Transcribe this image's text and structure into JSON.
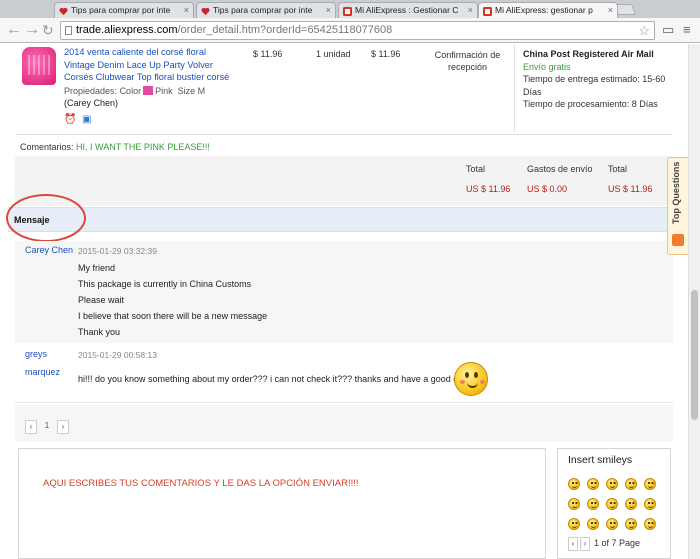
{
  "browser": {
    "tabs": [
      {
        "label": "Tips para comprar por inte",
        "favicon": "heart-icon",
        "active": false
      },
      {
        "label": "Tips para comprar por inte",
        "favicon": "heart-icon",
        "active": false
      },
      {
        "label": "Mi AliExpress : Gestionar C",
        "favicon": "aliexpress-icon",
        "active": false
      },
      {
        "label": "Mi AliExpress: gestionar p",
        "favicon": "aliexpress-icon",
        "active": true
      }
    ],
    "url_host": "trade.aliexpress.com",
    "url_path": "/order_detail.htm?orderId=65425118077608"
  },
  "order": {
    "product_title": "2014 venta caliente del corsé floral Vintage Denim Lace Up Party Volver Corsés Clubwear Top floral bustier corsé",
    "props_label": "Propiedades:",
    "color_label": "Color",
    "color_value": "Pink",
    "size_label": "Size",
    "size_value": "M",
    "buyer": "(Carey Chen)",
    "unit_price": "$ 11.96",
    "quantity": "1 unidad",
    "line_total": "$ 11.96",
    "status": "Confirmación de recepción",
    "shipping_method": "China Post Registered Air Mail",
    "shipping_cost": "Envío gratis",
    "delivery_label": "Tiempo de entrega estimado:",
    "delivery_value": "15-60 Días",
    "processing_label": "Tiempo de procesamiento:",
    "processing_value": "8 Días",
    "comments_label": "Comentarios:",
    "comments_value": "HI, I WANT THE PINK PLEASE!!!"
  },
  "totals": {
    "headers": [
      "Total",
      "Gastos de envío",
      "Total"
    ],
    "values": [
      "US $ 11.96",
      "US $ 0.00",
      "US $ 11.96"
    ]
  },
  "messages": {
    "header": "Mensaje",
    "items": [
      {
        "sender": "Carey Chen",
        "time": "2015-01-29 03:32:39",
        "lines": [
          "My friend",
          "This package is currently in China Customs",
          "Please wait",
          "I believe that soon there will be a new message",
          "Thank you"
        ]
      },
      {
        "sender": "greys marquez",
        "sender_line1": "greys",
        "sender_line2": "marquez",
        "time": "2015-01-29 00:58:13",
        "lines": [
          "hi!!! do you know something about my order??? i can not check it??? thanks and have a good day!!!"
        ]
      }
    ],
    "pager": {
      "prev": "‹",
      "page": "1",
      "next": "›"
    }
  },
  "compose": {
    "placeholder": "AQUI ESCRIBES TUS COMENTARIOS Y LE DAS LA OPCIÓN ENVIAR!!!!"
  },
  "smileys": {
    "title": "Insert smileys",
    "pager_text": "1 of 7 Page"
  },
  "side_tab": {
    "label": "Top Questions"
  }
}
